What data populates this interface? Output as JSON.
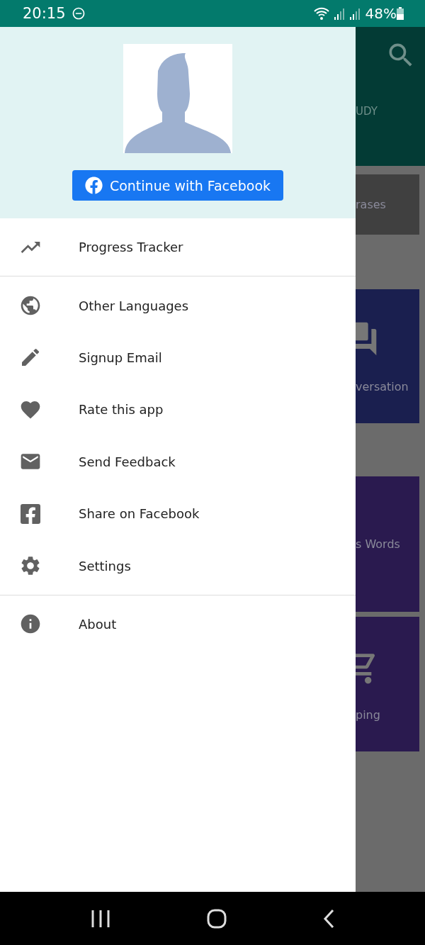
{
  "status_bar": {
    "time": "20:15",
    "battery": "48%"
  },
  "drawer": {
    "login_button": "Continue with Facebook",
    "sections": [
      [
        {
          "label": "Progress Tracker"
        }
      ],
      [
        {
          "label": "Other Languages"
        },
        {
          "label": "Signup Email"
        },
        {
          "label": "Rate this app"
        },
        {
          "label": "Send Feedback"
        },
        {
          "label": "Share on Facebook"
        },
        {
          "label": "Settings"
        }
      ],
      [
        {
          "label": "About"
        }
      ]
    ]
  },
  "background_screen": {
    "tab": "UDY",
    "cards": [
      {
        "label": "rases",
        "color": "#404040"
      },
      {
        "label": "versation",
        "color": "#1a1f4f"
      },
      {
        "label": "s Words",
        "color": "#2a1a4f"
      },
      {
        "label": "ping",
        "color": "#2a1a4f"
      }
    ]
  }
}
